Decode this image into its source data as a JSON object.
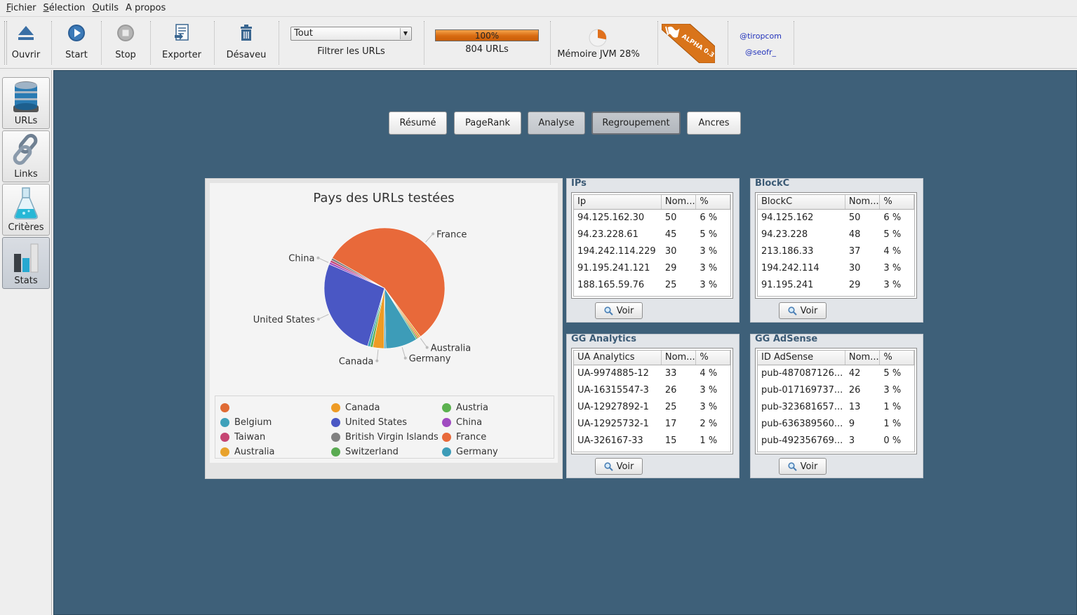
{
  "menu": [
    {
      "ul": "F",
      "rest": "ichier"
    },
    {
      "ul": "S",
      "rest": "élection"
    },
    {
      "ul": "O",
      "rest": "utils"
    },
    {
      "ul": "",
      "rest": "A propos"
    }
  ],
  "toolbar": {
    "open_label": "Ouvrir",
    "start_label": "Start",
    "stop_label": "Stop",
    "export_label": "Exporter",
    "disavow_label": "Désaveu",
    "filter_value": "Tout",
    "filter_label": "Filtrer les URLs",
    "progress_percent": 100,
    "progress_text": "100%",
    "urls_label": "804 URLs",
    "memory_label": "Mémoire JVM 28%",
    "memory_percent": 28,
    "alpha_badge": "ALPHA 0.3",
    "twitter_1": "@tiropcom",
    "twitter_2": "@seofr_"
  },
  "side_tabs": [
    {
      "label": "URLs",
      "icon": "database-icon",
      "active": false
    },
    {
      "label": "Links",
      "icon": "chain-link-icon",
      "active": false
    },
    {
      "label": "Critères",
      "icon": "flask-icon",
      "active": false
    },
    {
      "label": "Stats",
      "icon": "bar-chart-icon",
      "active": true
    }
  ],
  "nav_tabs": [
    {
      "label": "Résumé",
      "state": "normal"
    },
    {
      "label": "PageRank",
      "state": "normal"
    },
    {
      "label": "Analyse",
      "state": "selected"
    },
    {
      "label": "Regroupement",
      "state": "focused"
    },
    {
      "label": "Ancres",
      "state": "normal"
    }
  ],
  "chart_data": {
    "type": "pie",
    "title": "Pays des URLs testées",
    "slices": [
      {
        "label": "France",
        "value": 56.5,
        "color": "#e8693a"
      },
      {
        "label": "Australia",
        "value": 0.5,
        "color": "#e8a22c"
      },
      {
        "label": "",
        "value": 0.4,
        "color": "#e06b34"
      },
      {
        "label": "Switzerland",
        "value": 0.4,
        "color": "#5aab52"
      },
      {
        "label": "Germany",
        "value": 8.5,
        "color": "#3d9cb8"
      },
      {
        "label": "Belgium",
        "value": 0.5,
        "color": "#4aa3c0"
      },
      {
        "label": "Canada",
        "value": 3.0,
        "color": "#ee9b25"
      },
      {
        "label": "Austria",
        "value": 0.7,
        "color": "#5bb14f"
      },
      {
        "label": "Belgium",
        "value": 0.7,
        "color": "#3fa1ba"
      },
      {
        "label": "United States",
        "value": 27.0,
        "color": "#4a57c4"
      },
      {
        "label": "China",
        "value": 0.6,
        "color": "#a04bc1"
      },
      {
        "label": "Taiwan",
        "value": 0.6,
        "color": "#c54572"
      },
      {
        "label": "British Virgin Islands",
        "value": 0.6,
        "color": "#808080"
      }
    ],
    "callouts": [
      "France",
      "Australia",
      "Germany",
      "Canada",
      "United States",
      "China"
    ],
    "legend": [
      {
        "label": "",
        "color": "#e06b34"
      },
      {
        "label": "Canada",
        "color": "#ee9b25"
      },
      {
        "label": "Austria",
        "color": "#5bb14f"
      },
      {
        "label": "Belgium",
        "color": "#3fa1ba"
      },
      {
        "label": "United States",
        "color": "#4a57c4"
      },
      {
        "label": "China",
        "color": "#a04bc1"
      },
      {
        "label": "Taiwan",
        "color": "#c54572"
      },
      {
        "label": "British Virgin Islands",
        "color": "#808080"
      },
      {
        "label": "France",
        "color": "#e8693a"
      },
      {
        "label": "Australia",
        "color": "#e8a22c"
      },
      {
        "label": "Switzerland",
        "color": "#5aab52"
      },
      {
        "label": "Germany",
        "color": "#3d9cb8"
      }
    ]
  },
  "tables": [
    {
      "title": "IPs",
      "headers": [
        "Ip",
        "Nom...",
        "%"
      ],
      "rows": [
        [
          "94.125.162.30",
          "50",
          "6 %"
        ],
        [
          "94.23.228.61",
          "45",
          "5 %"
        ],
        [
          "194.242.114.229",
          "30",
          "3 %"
        ],
        [
          "91.195.241.121",
          "29",
          "3 %"
        ],
        [
          "188.165.59.76",
          "25",
          "3 %"
        ]
      ],
      "button": "Voir"
    },
    {
      "title": "BlockC",
      "headers": [
        "BlockC",
        "Nom...",
        "%"
      ],
      "rows": [
        [
          "94.125.162",
          "50",
          "6 %"
        ],
        [
          "94.23.228",
          "48",
          "5 %"
        ],
        [
          "213.186.33",
          "37",
          "4 %"
        ],
        [
          "194.242.114",
          "30",
          "3 %"
        ],
        [
          "91.195.241",
          "29",
          "3 %"
        ]
      ],
      "button": "Voir"
    },
    {
      "title": "GG Analytics",
      "headers": [
        "UA Analytics",
        "Nom...",
        "%"
      ],
      "rows": [
        [
          "UA-9974885-12",
          "33",
          "4 %"
        ],
        [
          "UA-16315547-3",
          "26",
          "3 %"
        ],
        [
          "UA-12927892-1",
          "25",
          "3 %"
        ],
        [
          "UA-12925732-1",
          "17",
          "2 %"
        ],
        [
          "UA-326167-33",
          "15",
          "1 %"
        ]
      ],
      "button": "Voir"
    },
    {
      "title": "GG AdSense",
      "headers": [
        "ID AdSense",
        "Nom...",
        "%"
      ],
      "rows": [
        [
          "pub-487087126...",
          "42",
          "5 %"
        ],
        [
          "pub-017169737...",
          "26",
          "3 %"
        ],
        [
          "pub-323681657...",
          "13",
          "1 %"
        ],
        [
          "pub-636389560...",
          "9",
          "1 %"
        ],
        [
          "pub-492356769...",
          "3",
          "0 %"
        ]
      ],
      "button": "Voir"
    }
  ]
}
